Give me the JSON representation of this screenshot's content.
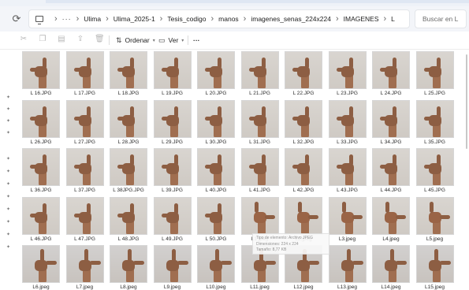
{
  "address": {
    "crumbs": [
      "Ulima",
      "Ulima_2025-1",
      "Tesis_codigo",
      "manos",
      "imagenes_senas_224x224",
      "IMAGENES",
      "L"
    ],
    "more_label": "···",
    "search_placeholder": "Buscar en L"
  },
  "toolbar": {
    "sort_label": "Ordenar",
    "view_label": "Ver",
    "more_label": "···"
  },
  "files": [
    "L 16.JPG",
    "L 17.JPG",
    "L 18.JPG",
    "L 19.JPG",
    "L 20.JPG",
    "L 21.JPG",
    "L 22.JPG",
    "L 23.JPG",
    "L 24.JPG",
    "L 25.JPG",
    "L 26.JPG",
    "L 27.JPG",
    "L 28.JPG",
    "L 29.JPG",
    "L 30.JPG",
    "L 31.JPG",
    "L 32.JPG",
    "L 33.JPG",
    "L 34.JPG",
    "L 35.JPG",
    "L 36.JPG",
    "L 37.JPG",
    "L 38JPG.JPG",
    "L 39.JPG",
    "L 40.JPG",
    "L 41.JPG",
    "L 42.JPG",
    "L 43.JPG",
    "L 44.JPG",
    "L 45.JPG",
    "L 46.JPG",
    "L 47.JPG",
    "L 48.JPG",
    "L 49.JPG",
    "L 50.JPG",
    "L1.jpeg",
    "L2.jpeg",
    "L3.jpeg",
    "L4.jpeg",
    "L5.jpeg",
    "L6.jpeg",
    "L7.jpeg",
    "L8.jpeg",
    "L9.jpeg",
    "L10.jpeg",
    "L11.jpeg",
    "L12.jpeg",
    "L13.jpeg",
    "L14.jpeg",
    "L15.jpeg"
  ],
  "tooltip": {
    "lines": [
      "Tipo de elemento: Archivo JPEG",
      "Dimensiones: 224 x 224",
      "Tamaño: 8,77 KB"
    ]
  },
  "icons": {
    "refresh": "refresh-icon",
    "pc": "this-pc-icon",
    "pin": "pin-icon"
  }
}
